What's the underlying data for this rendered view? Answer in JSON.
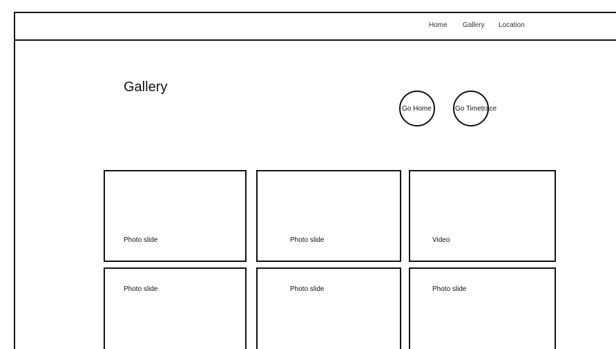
{
  "nav": {
    "items": [
      {
        "label": "Home"
      },
      {
        "label": "Gallery"
      },
      {
        "label": "Location"
      }
    ]
  },
  "page": {
    "title": "Gallery"
  },
  "actions": {
    "go_home": "Go Home",
    "go_timetrace": "Go Timetrace"
  },
  "tiles": [
    {
      "label": "Photo slide"
    },
    {
      "label": "Photo slide"
    },
    {
      "label": "Video"
    },
    {
      "label": "Photo slide"
    },
    {
      "label": "Photo slide"
    },
    {
      "label": "Photo slide"
    }
  ]
}
